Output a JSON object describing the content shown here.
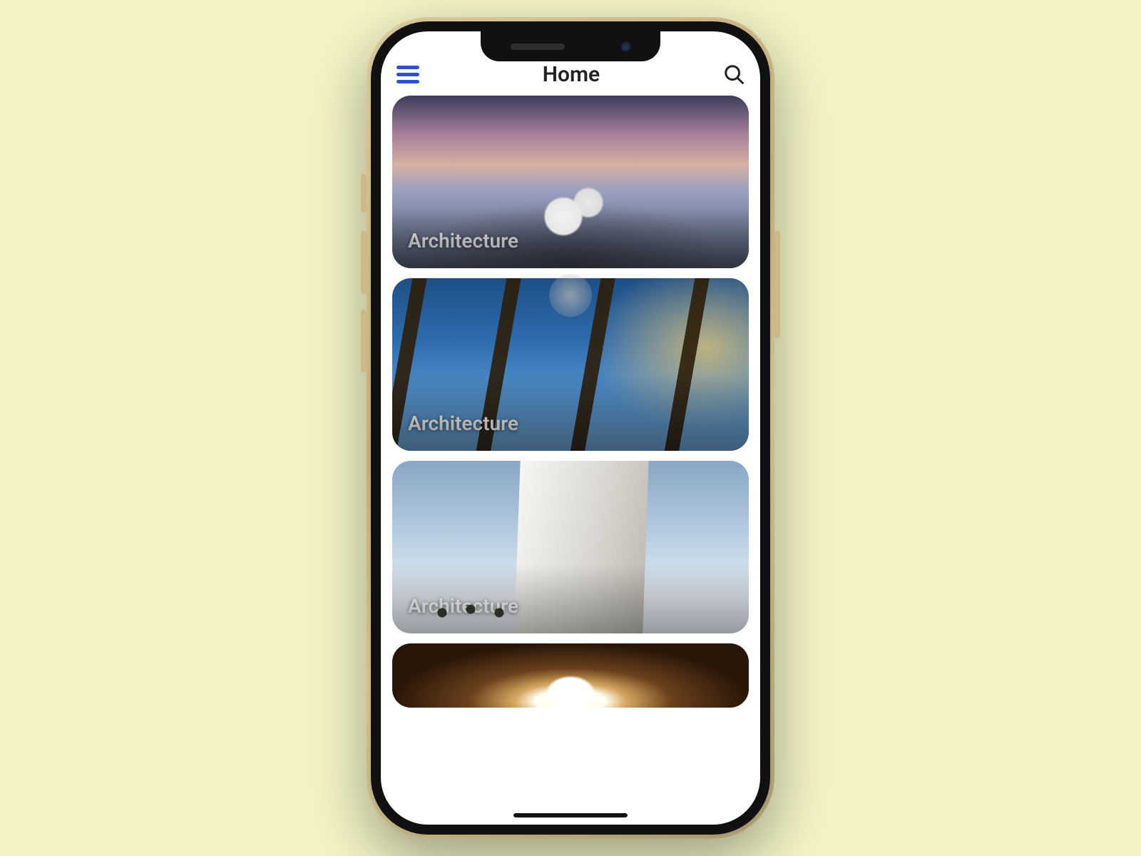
{
  "header": {
    "title": "Home",
    "menu_icon": "hamburger-icon",
    "search_icon": "search-icon"
  },
  "cards": [
    {
      "label": "Architecture"
    },
    {
      "label": "Architecture"
    },
    {
      "label": "Architecture"
    },
    {
      "label": ""
    }
  ],
  "colors": {
    "page_bg": "#f3f3c5",
    "accent": "#2f4fd1"
  }
}
